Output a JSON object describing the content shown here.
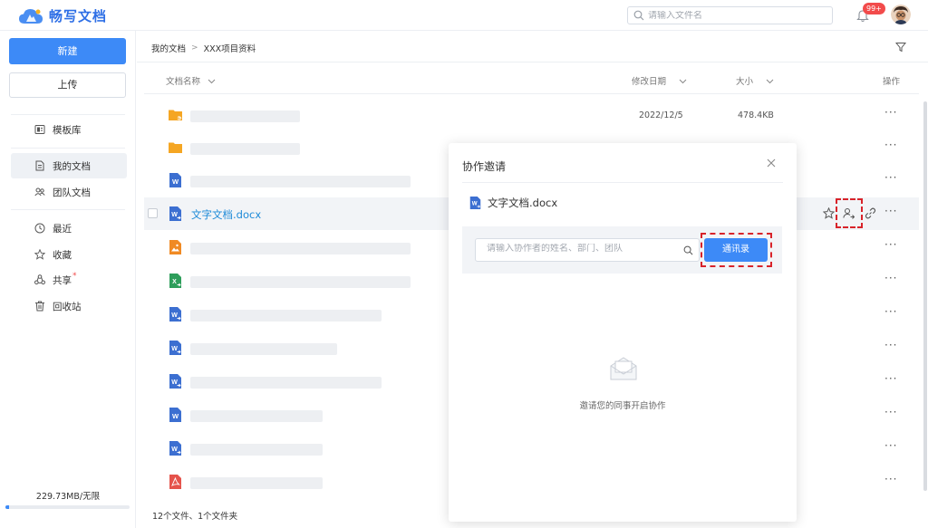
{
  "app": {
    "name": "畅写文档"
  },
  "header": {
    "search_placeholder": "请输入文件名",
    "notification_badge": "99+"
  },
  "sidebar": {
    "new_label": "新建",
    "upload_label": "上传",
    "items": [
      {
        "label": "模板库",
        "icon": "template-icon"
      },
      {
        "label": "我的文档",
        "icon": "document-icon",
        "active": true
      },
      {
        "label": "团队文档",
        "icon": "team-icon"
      },
      {
        "label": "最近",
        "icon": "clock-icon"
      },
      {
        "label": "收藏",
        "icon": "star-icon"
      },
      {
        "label": "共享",
        "icon": "share-icon",
        "marker": "*"
      },
      {
        "label": "回收站",
        "icon": "trash-icon"
      }
    ],
    "storage": "229.73MB/无限",
    "storage_used_fraction": 0.03
  },
  "main": {
    "breadcrumb": [
      "我的文档",
      "XXX项目资料"
    ],
    "breadcrumb_separator": ">",
    "columns": {
      "name": "文档名称",
      "modified": "修改日期",
      "size": "大小",
      "actions": "操作"
    },
    "rows": [
      {
        "type": "folder-shared",
        "date": "2022/12/5",
        "size": "478.4KB"
      },
      {
        "type": "folder"
      },
      {
        "type": "word"
      },
      {
        "type": "word-shared",
        "name": "文字文档.docx",
        "highlighted": true
      },
      {
        "type": "image"
      },
      {
        "type": "excel-shared"
      },
      {
        "type": "word-shared"
      },
      {
        "type": "word-shared"
      },
      {
        "type": "word-shared"
      },
      {
        "type": "word"
      },
      {
        "type": "word-shared"
      },
      {
        "type": "pdf"
      }
    ],
    "more_label": "···",
    "footer": "12个文件、1个文件夹"
  },
  "modal": {
    "title": "协作邀请",
    "file_name": "文字文档.docx",
    "input_placeholder": "请输入协作者的姓名、部门、团队",
    "contacts_button": "通讯录",
    "empty_text": "邀请您的同事开启协作"
  },
  "colors": {
    "accent": "#3d8af7",
    "link": "#1f8bd8",
    "badge": "#f24b4b",
    "highlight_dash": "#d8232a",
    "folder": "#f5a623",
    "word": "#3c6fd1",
    "excel": "#2e9e5b",
    "pdf": "#e5534b",
    "image": "#f08a24"
  }
}
